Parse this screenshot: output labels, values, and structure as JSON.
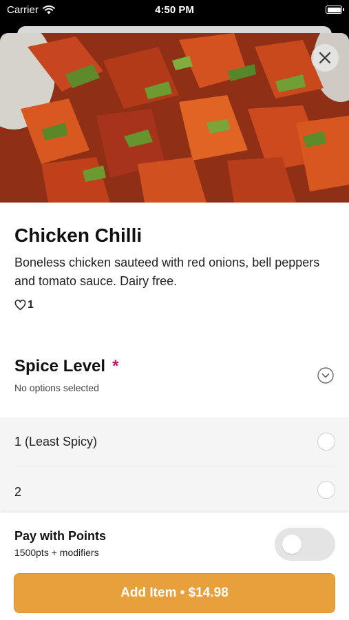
{
  "status_bar": {
    "carrier": "Carrier",
    "time": "4:50 PM"
  },
  "item": {
    "title": "Chicken Chilli",
    "description": "Boneless chicken sauteed with red onions, bell peppers and tomato sauce. Dairy free.",
    "likes": "1"
  },
  "spice": {
    "title": "Spice Level",
    "required_mark": "*",
    "subtitle": "No options selected",
    "options": [
      {
        "label": "1 (Least Spicy)",
        "selected": false
      },
      {
        "label": "2",
        "selected": false
      }
    ]
  },
  "footer": {
    "pay_title": "Pay with Points",
    "pay_sub": "1500pts + modifiers",
    "pay_with_points_enabled": false,
    "add_button": "Add Item • $14.98"
  },
  "colors": {
    "accent": "#e7a03b",
    "required": "#c2185b"
  }
}
